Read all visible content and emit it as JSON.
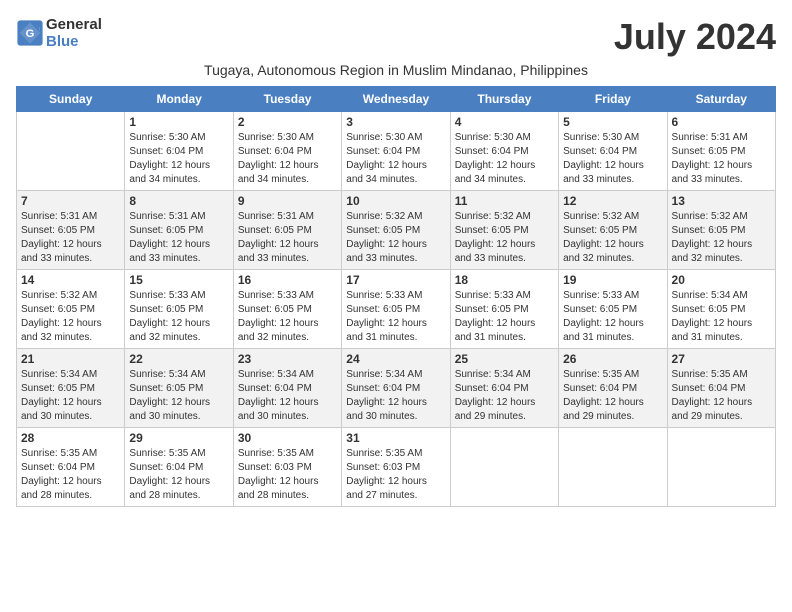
{
  "header": {
    "logo_line1": "General",
    "logo_line2": "Blue",
    "month_title": "July 2024",
    "subtitle": "Tugaya, Autonomous Region in Muslim Mindanao, Philippines"
  },
  "days_of_week": [
    "Sunday",
    "Monday",
    "Tuesday",
    "Wednesday",
    "Thursday",
    "Friday",
    "Saturday"
  ],
  "weeks": [
    [
      {
        "day": "",
        "info": ""
      },
      {
        "day": "1",
        "info": "Sunrise: 5:30 AM\nSunset: 6:04 PM\nDaylight: 12 hours\nand 34 minutes."
      },
      {
        "day": "2",
        "info": "Sunrise: 5:30 AM\nSunset: 6:04 PM\nDaylight: 12 hours\nand 34 minutes."
      },
      {
        "day": "3",
        "info": "Sunrise: 5:30 AM\nSunset: 6:04 PM\nDaylight: 12 hours\nand 34 minutes."
      },
      {
        "day": "4",
        "info": "Sunrise: 5:30 AM\nSunset: 6:04 PM\nDaylight: 12 hours\nand 34 minutes."
      },
      {
        "day": "5",
        "info": "Sunrise: 5:30 AM\nSunset: 6:04 PM\nDaylight: 12 hours\nand 33 minutes."
      },
      {
        "day": "6",
        "info": "Sunrise: 5:31 AM\nSunset: 6:05 PM\nDaylight: 12 hours\nand 33 minutes."
      }
    ],
    [
      {
        "day": "7",
        "info": "Sunrise: 5:31 AM\nSunset: 6:05 PM\nDaylight: 12 hours\nand 33 minutes."
      },
      {
        "day": "8",
        "info": "Sunrise: 5:31 AM\nSunset: 6:05 PM\nDaylight: 12 hours\nand 33 minutes."
      },
      {
        "day": "9",
        "info": "Sunrise: 5:31 AM\nSunset: 6:05 PM\nDaylight: 12 hours\nand 33 minutes."
      },
      {
        "day": "10",
        "info": "Sunrise: 5:32 AM\nSunset: 6:05 PM\nDaylight: 12 hours\nand 33 minutes."
      },
      {
        "day": "11",
        "info": "Sunrise: 5:32 AM\nSunset: 6:05 PM\nDaylight: 12 hours\nand 33 minutes."
      },
      {
        "day": "12",
        "info": "Sunrise: 5:32 AM\nSunset: 6:05 PM\nDaylight: 12 hours\nand 32 minutes."
      },
      {
        "day": "13",
        "info": "Sunrise: 5:32 AM\nSunset: 6:05 PM\nDaylight: 12 hours\nand 32 minutes."
      }
    ],
    [
      {
        "day": "14",
        "info": "Sunrise: 5:32 AM\nSunset: 6:05 PM\nDaylight: 12 hours\nand 32 minutes."
      },
      {
        "day": "15",
        "info": "Sunrise: 5:33 AM\nSunset: 6:05 PM\nDaylight: 12 hours\nand 32 minutes."
      },
      {
        "day": "16",
        "info": "Sunrise: 5:33 AM\nSunset: 6:05 PM\nDaylight: 12 hours\nand 32 minutes."
      },
      {
        "day": "17",
        "info": "Sunrise: 5:33 AM\nSunset: 6:05 PM\nDaylight: 12 hours\nand 31 minutes."
      },
      {
        "day": "18",
        "info": "Sunrise: 5:33 AM\nSunset: 6:05 PM\nDaylight: 12 hours\nand 31 minutes."
      },
      {
        "day": "19",
        "info": "Sunrise: 5:33 AM\nSunset: 6:05 PM\nDaylight: 12 hours\nand 31 minutes."
      },
      {
        "day": "20",
        "info": "Sunrise: 5:34 AM\nSunset: 6:05 PM\nDaylight: 12 hours\nand 31 minutes."
      }
    ],
    [
      {
        "day": "21",
        "info": "Sunrise: 5:34 AM\nSunset: 6:05 PM\nDaylight: 12 hours\nand 30 minutes."
      },
      {
        "day": "22",
        "info": "Sunrise: 5:34 AM\nSunset: 6:05 PM\nDaylight: 12 hours\nand 30 minutes."
      },
      {
        "day": "23",
        "info": "Sunrise: 5:34 AM\nSunset: 6:04 PM\nDaylight: 12 hours\nand 30 minutes."
      },
      {
        "day": "24",
        "info": "Sunrise: 5:34 AM\nSunset: 6:04 PM\nDaylight: 12 hours\nand 30 minutes."
      },
      {
        "day": "25",
        "info": "Sunrise: 5:34 AM\nSunset: 6:04 PM\nDaylight: 12 hours\nand 29 minutes."
      },
      {
        "day": "26",
        "info": "Sunrise: 5:35 AM\nSunset: 6:04 PM\nDaylight: 12 hours\nand 29 minutes."
      },
      {
        "day": "27",
        "info": "Sunrise: 5:35 AM\nSunset: 6:04 PM\nDaylight: 12 hours\nand 29 minutes."
      }
    ],
    [
      {
        "day": "28",
        "info": "Sunrise: 5:35 AM\nSunset: 6:04 PM\nDaylight: 12 hours\nand 28 minutes."
      },
      {
        "day": "29",
        "info": "Sunrise: 5:35 AM\nSunset: 6:04 PM\nDaylight: 12 hours\nand 28 minutes."
      },
      {
        "day": "30",
        "info": "Sunrise: 5:35 AM\nSunset: 6:03 PM\nDaylight: 12 hours\nand 28 minutes."
      },
      {
        "day": "31",
        "info": "Sunrise: 5:35 AM\nSunset: 6:03 PM\nDaylight: 12 hours\nand 27 minutes."
      },
      {
        "day": "",
        "info": ""
      },
      {
        "day": "",
        "info": ""
      },
      {
        "day": "",
        "info": ""
      }
    ]
  ]
}
